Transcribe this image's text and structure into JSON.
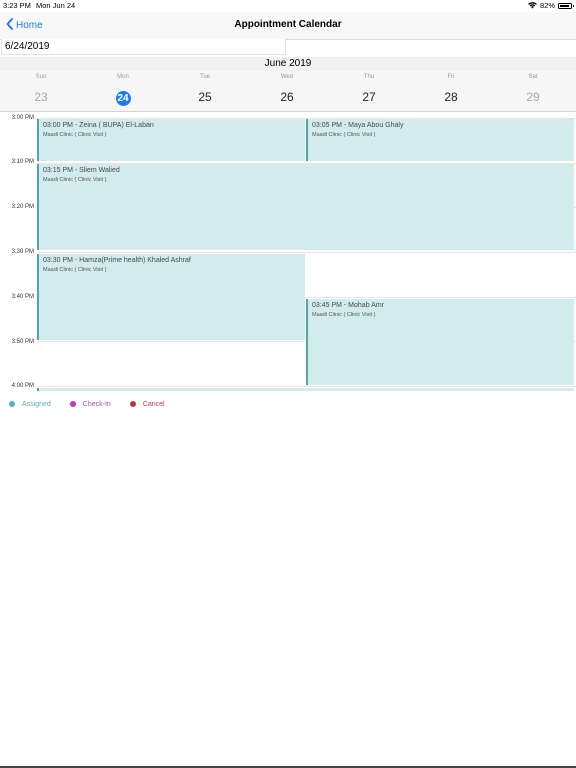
{
  "status_bar": {
    "time": "3:23 PM",
    "date": "Mon Jun 24",
    "battery": "82%"
  },
  "nav": {
    "back_label": "Home",
    "title": "Appointment Calendar"
  },
  "date_field": {
    "value": "6/24/2019"
  },
  "month_label": "June 2019",
  "week": [
    {
      "name": "Sun",
      "num": "23",
      "weekend": true
    },
    {
      "name": "Mon",
      "num": "24",
      "selected": true
    },
    {
      "name": "Tue",
      "num": "25"
    },
    {
      "name": "Wed",
      "num": "26"
    },
    {
      "name": "Thu",
      "num": "27"
    },
    {
      "name": "Fri",
      "num": "28"
    },
    {
      "name": "Sat",
      "num": "29",
      "weekend": true
    }
  ],
  "time_labels": [
    "3:00 PM",
    "3:10 PM",
    "3:20 PM",
    "3:30 PM",
    "3:40 PM",
    "3:50 PM",
    "4:00 PM"
  ],
  "events": [
    {
      "title": "03:00 PM - Zeina ( BUPA) El-Laban",
      "subtitle": "Maadi Clinic ( Clinic Visit )"
    },
    {
      "title": "03:05 PM - Maya Abou Ghaly",
      "subtitle": "Maadi Clinic ( Clinic Visit )"
    },
    {
      "title": "03:15 PM - Sliem Walied",
      "subtitle": "Maadi Clinic ( Clinic Visit )"
    },
    {
      "title": "03:30 PM - Hamza(Prime health) Khaled Ashraf",
      "subtitle": "Maadi Clinic ( Clinic Visit )"
    },
    {
      "title": "03:45 PM - Mohab Amr",
      "subtitle": "Maadi Clinic ( Clinic Visit )"
    },
    {
      "title": "",
      "subtitle": ""
    }
  ],
  "legend": [
    {
      "label": "Assigned",
      "color": "#4fb6b0",
      "text_color": "#5aaeb0"
    },
    {
      "label": "Check-In",
      "color": "#c734b9",
      "text_color": "#b04fb0"
    },
    {
      "label": "Cancel",
      "color": "#c9303e",
      "text_color": "#c0454e"
    }
  ]
}
